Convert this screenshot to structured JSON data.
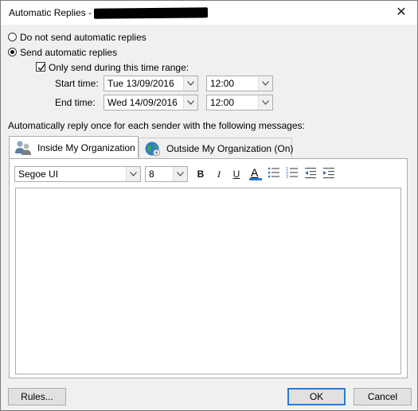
{
  "window": {
    "title": "Automatic Replies -",
    "close_glyph": "✕"
  },
  "options": {
    "do_not_send_label": "Do not send automatic replies",
    "send_label": "Send automatic replies",
    "selected": "send"
  },
  "time_range": {
    "checkbox_label": "Only send during this time range:",
    "checked": true,
    "start_label": "Start time:",
    "start_date": "Tue 13/09/2016",
    "start_time": "12:00",
    "end_label": "End time:",
    "end_date": "Wed 14/09/2016",
    "end_time": "12:00"
  },
  "message": {
    "instruction": "Automatically reply once for each sender with the following messages:"
  },
  "tabs": [
    {
      "label": "Inside My Organization",
      "icon": "people-icon",
      "active": true
    },
    {
      "label": "Outside My Organization (On)",
      "icon": "globe-icon",
      "active": false
    }
  ],
  "format_toolbar": {
    "font": "Segoe UI",
    "size": "8",
    "bold": "B",
    "italic": "I",
    "underline": "U",
    "font_color": "A",
    "bullets_icon": "bullets-icon",
    "numbering_icon": "numbering-icon",
    "decrease_indent_icon": "decrease-indent-icon",
    "increase_indent_icon": "increase-indent-icon"
  },
  "buttons": {
    "rules": "Rules...",
    "ok": "OK",
    "cancel": "Cancel"
  },
  "colors": {
    "accent": "#2a7ad6",
    "font_color_bar": "#2a7ad6",
    "globe_green": "#3aa35a",
    "globe_blue": "#2d7fc4"
  }
}
